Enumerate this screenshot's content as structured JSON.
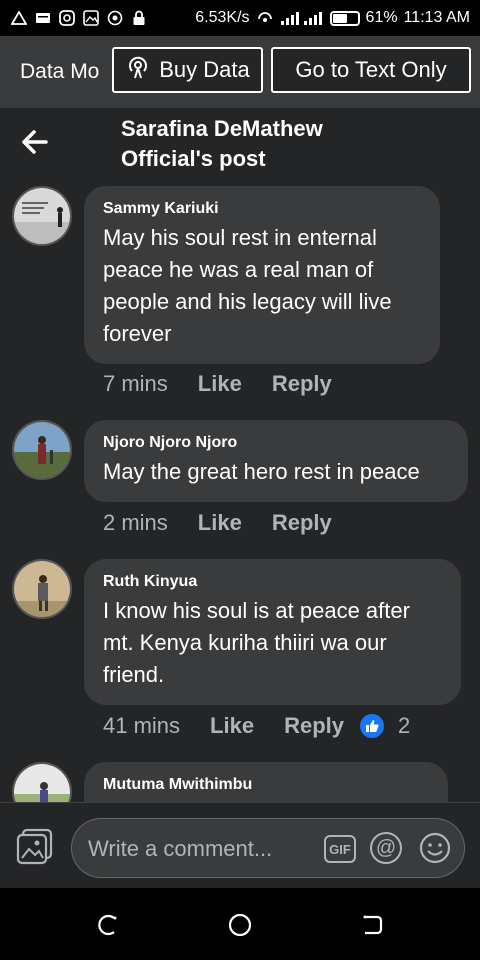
{
  "status": {
    "speed": "6.53K/s",
    "battery": "61%",
    "battery_level": 0.61,
    "time": "11:13 AM"
  },
  "databar": {
    "mode_label": "Data Mo",
    "buy_label": "Buy Data",
    "text_only_label": "Go to Text Only"
  },
  "header": {
    "title_line1": "Sarafina DeMathew",
    "title_line2": "Official's post"
  },
  "comments": [
    {
      "author": "Sammy Kariuki",
      "text": "May his soul rest in enternal peace he was a real man of people and his legacy will live forever",
      "time": "7 mins",
      "like": "Like",
      "reply": "Reply"
    },
    {
      "author": "Njoro Njoro Njoro",
      "text": "May the great hero rest in peace",
      "time": "2 mins",
      "like": "Like",
      "reply": "Reply"
    },
    {
      "author": "Ruth Kinyua",
      "text": "I know his soul is at peace after mt. Kenya kuriha thiiri wa our friend.",
      "time": "41 mins",
      "like": "Like",
      "reply": "Reply",
      "reactions": "2"
    },
    {
      "author": "Mutuma Mwithimbu",
      "text": ""
    }
  ],
  "composer": {
    "placeholder": "Write a comment...",
    "gif_label": "GIF",
    "at_label": "@"
  },
  "colors": {
    "accent": "#1877f2",
    "bubble": "#3a3b3c",
    "background": "#242526"
  }
}
